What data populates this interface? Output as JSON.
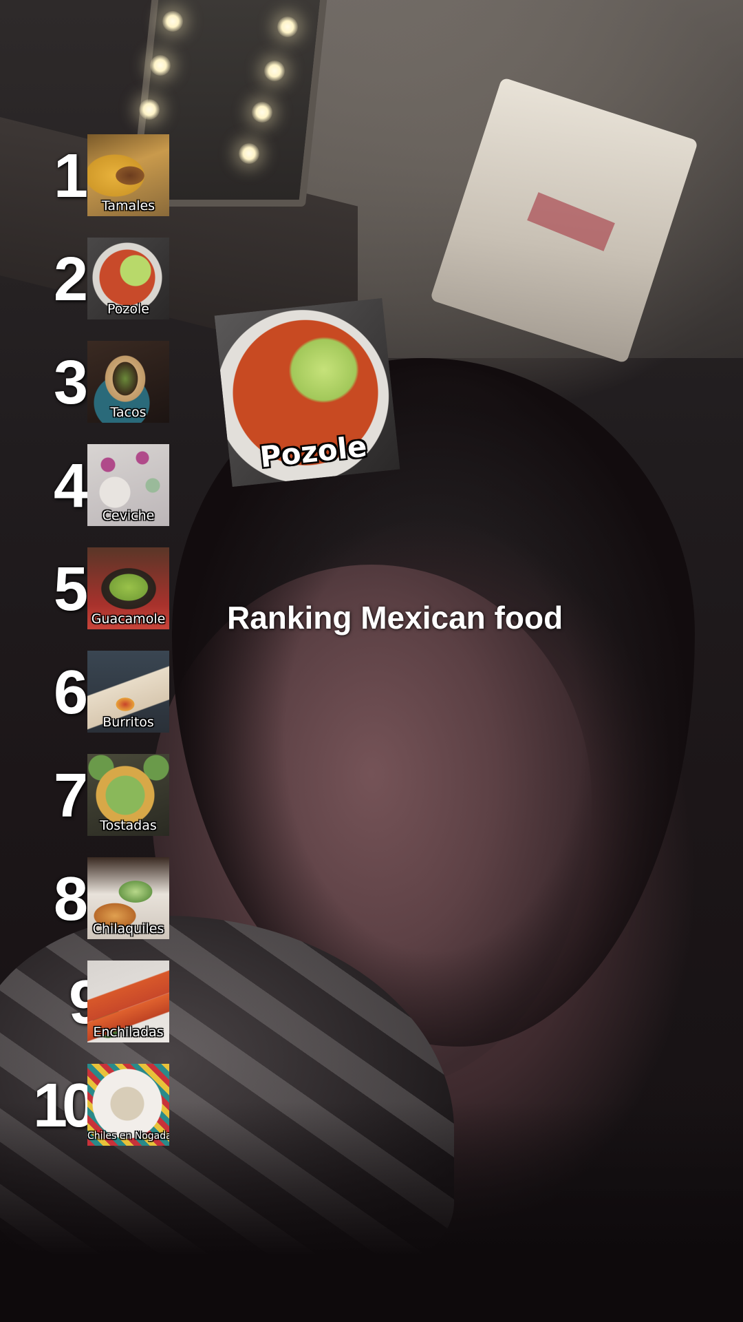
{
  "title": "Ranking Mexican food",
  "selected_item": {
    "label": "Pozole",
    "icon": "pozole-image"
  },
  "rankings": [
    {
      "rank": "1",
      "label": "Tamales",
      "icon": "tamales-image"
    },
    {
      "rank": "2",
      "label": "Pozole",
      "icon": "pozole-image"
    },
    {
      "rank": "3",
      "label": "Tacos",
      "icon": "tacos-image"
    },
    {
      "rank": "4",
      "label": "Ceviche",
      "icon": "ceviche-image"
    },
    {
      "rank": "5",
      "label": "Guacamole",
      "icon": "guacamole-image"
    },
    {
      "rank": "6",
      "label": "Burritos",
      "icon": "burritos-image"
    },
    {
      "rank": "7",
      "label": "Tostadas",
      "icon": "tostadas-image"
    },
    {
      "rank": "8",
      "label": "Chilaquiles",
      "icon": "chilaquiles-image"
    },
    {
      "rank": "9",
      "label": "Enchiladas",
      "icon": "enchiladas-image"
    },
    {
      "rank": "10",
      "label": "Chiles en Nogada",
      "icon": "chiles-en-nogada-image"
    }
  ]
}
